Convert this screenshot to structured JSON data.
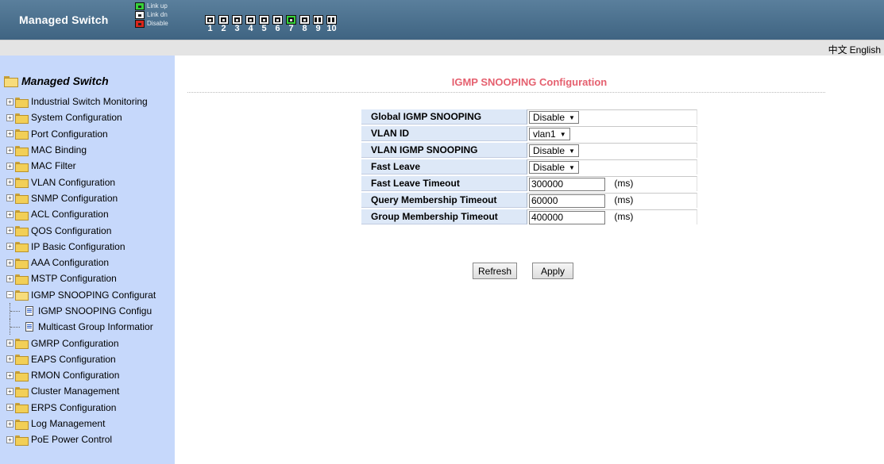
{
  "header": {
    "title": "Managed Switch",
    "legend": [
      {
        "label": "Link up",
        "icon": "port-link-up-icon",
        "color": "#37d23a"
      },
      {
        "label": "Link dn",
        "icon": "port-link-down-icon",
        "color": "#f4f4f4"
      },
      {
        "label": "Disable",
        "icon": "port-disabled-icon",
        "color": "#d9261c"
      }
    ],
    "ports": [
      {
        "num": "1",
        "status": "down",
        "type": "copper"
      },
      {
        "num": "2",
        "status": "down",
        "type": "copper"
      },
      {
        "num": "3",
        "status": "down",
        "type": "copper"
      },
      {
        "num": "4",
        "status": "down",
        "type": "copper"
      },
      {
        "num": "5",
        "status": "down",
        "type": "copper"
      },
      {
        "num": "6",
        "status": "down",
        "type": "copper"
      },
      {
        "num": "7",
        "status": "up",
        "type": "copper"
      },
      {
        "num": "8",
        "status": "down",
        "type": "copper"
      },
      {
        "num": "9",
        "status": "down",
        "type": "fiber"
      },
      {
        "num": "10",
        "status": "down",
        "type": "fiber"
      }
    ]
  },
  "lang": {
    "chinese": "中文",
    "english": "English"
  },
  "sidebar": {
    "root": "Managed Switch",
    "items": [
      {
        "label": "Industrial Switch Monitoring",
        "type": "folder"
      },
      {
        "label": "System Configuration",
        "type": "folder"
      },
      {
        "label": "Port Configuration",
        "type": "folder"
      },
      {
        "label": "MAC Binding",
        "type": "folder"
      },
      {
        "label": "MAC Filter",
        "type": "folder"
      },
      {
        "label": "VLAN Configuration",
        "type": "folder"
      },
      {
        "label": "SNMP Configuration",
        "type": "folder"
      },
      {
        "label": "ACL Configuration",
        "type": "folder"
      },
      {
        "label": "QOS Configuration",
        "type": "folder"
      },
      {
        "label": "IP Basic Configuration",
        "type": "folder"
      },
      {
        "label": "AAA Configuration",
        "type": "folder"
      },
      {
        "label": "MSTP Configuration",
        "type": "folder"
      },
      {
        "label": "IGMP SNOOPING Configurat",
        "type": "folder-open"
      },
      {
        "label": "IGMP SNOOPING Configu",
        "type": "doc"
      },
      {
        "label": "Multicast Group Informatior",
        "type": "doc"
      },
      {
        "label": "GMRP Configuration",
        "type": "folder"
      },
      {
        "label": "EAPS Configuration",
        "type": "folder"
      },
      {
        "label": "RMON Configuration",
        "type": "folder"
      },
      {
        "label": "Cluster Management",
        "type": "folder"
      },
      {
        "label": "ERPS Configuration",
        "type": "folder"
      },
      {
        "label": "Log Management",
        "type": "folder"
      },
      {
        "label": "PoE Power Control",
        "type": "folder"
      }
    ]
  },
  "main": {
    "title": "IGMP SNOOPING Configuration",
    "fields": {
      "global_igmp": {
        "label": "Global IGMP SNOOPING",
        "value": "Disable"
      },
      "vlan_id": {
        "label": "VLAN ID",
        "value": "vlan1"
      },
      "vlan_igmp": {
        "label": "VLAN IGMP SNOOPING",
        "value": "Disable"
      },
      "fast_leave": {
        "label": "Fast Leave",
        "value": "Disable"
      },
      "fast_leave_timeout": {
        "label": "Fast Leave Timeout",
        "value": "300000",
        "unit": "(ms)"
      },
      "query_timeout": {
        "label": "Query Membership Timeout",
        "value": "60000",
        "unit": "(ms)"
      },
      "group_timeout": {
        "label": "Group Membership Timeout",
        "value": "400000",
        "unit": "(ms)"
      }
    },
    "buttons": {
      "refresh": "Refresh",
      "apply": "Apply"
    }
  }
}
